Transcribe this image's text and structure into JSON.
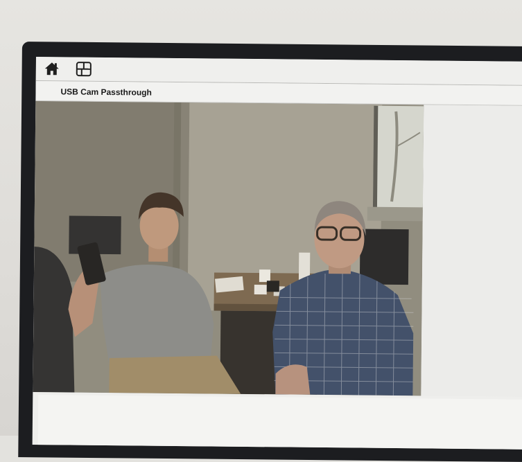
{
  "toolbar": {
    "home_icon": "home-icon",
    "layout_icon": "layout-grid-icon"
  },
  "page": {
    "title": "USB Cam Passthrough"
  },
  "colors": {
    "bezel": "#1c1d20",
    "screen_bg": "#eeeeec",
    "toolbar_border": "#b9b9b6"
  }
}
